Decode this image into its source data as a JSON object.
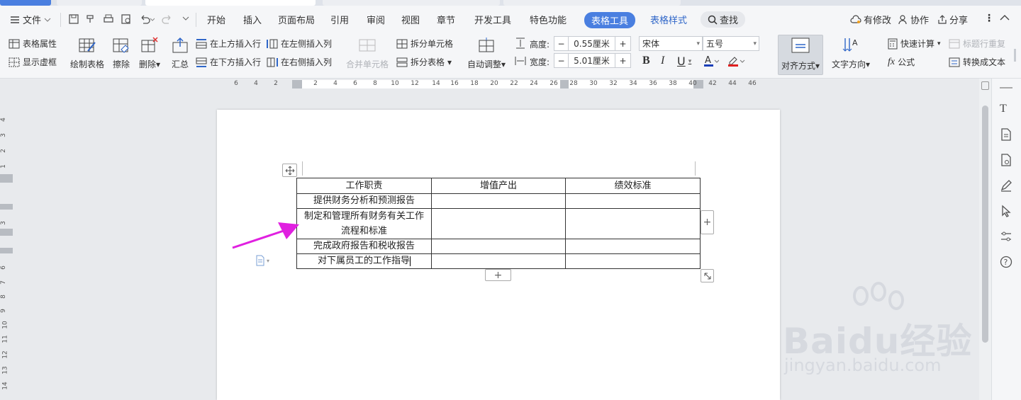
{
  "menubar": {
    "file_label": "文件",
    "tabs": [
      "开始",
      "插入",
      "页面布局",
      "引用",
      "审阅",
      "视图",
      "章节",
      "开发工具",
      "特色功能"
    ],
    "active_tab": "表格工具",
    "style_tab": "表格样式",
    "search_label": "查找",
    "modified_label": "有修改",
    "collab_label": "协作",
    "share_label": "分享"
  },
  "ribbon": {
    "table_props": "表格属性",
    "show_grid": "显示虚框",
    "draw_table": "绘制表格",
    "erase": "擦除",
    "delete": "删除",
    "summary": "汇总",
    "insert_above": "在上方插入行",
    "insert_below": "在下方插入行",
    "insert_left": "在左侧插入列",
    "insert_right": "在右侧插入列",
    "merge_cells": "合并单元格",
    "split_cells": "拆分单元格",
    "split_table": "拆分表格",
    "auto_fit": "自动调整",
    "height_label": "高度:",
    "height_value": "0.55厘米",
    "width_label": "宽度:",
    "width_value": "5.01厘米",
    "font_name": "宋体",
    "font_size": "五号",
    "align": "对齐方式",
    "text_dir": "文字方向",
    "quick_calc": "快速计算",
    "repeat_header": "标题行重复",
    "formula": "公式",
    "to_text": "转换成文本",
    "colors": {
      "font": "#1a3fb8",
      "highlight": "#e02020"
    }
  },
  "ruler": {
    "h_ticks": [
      "6",
      "4",
      "2",
      "2",
      "4",
      "6",
      "8",
      "10",
      "12",
      "14",
      "16",
      "18",
      "20",
      "22",
      "24",
      "26",
      "28",
      "30",
      "32",
      "34",
      "36",
      "38",
      "40",
      "42",
      "44",
      "46"
    ],
    "v_ticks": [
      "4",
      "3",
      "2",
      "1",
      "3",
      "6",
      "7",
      "8",
      "9",
      "10",
      "11",
      "12",
      "13",
      "14"
    ]
  },
  "table": {
    "headers": [
      "工作职责",
      "增值产出",
      "绩效标准"
    ],
    "rows": [
      [
        "提供财务分析和预测报告",
        "",
        ""
      ],
      [
        "制定和管理所有财务有关工作流程和标准",
        "",
        ""
      ],
      [
        "完成政府报告和税收报告",
        "",
        ""
      ],
      [
        "对下属员工的工作指导",
        "",
        ""
      ]
    ]
  },
  "watermark": {
    "brand": "Baidu经验",
    "url": "jingyan.baidu.com"
  },
  "accent": "#4a7fe0"
}
